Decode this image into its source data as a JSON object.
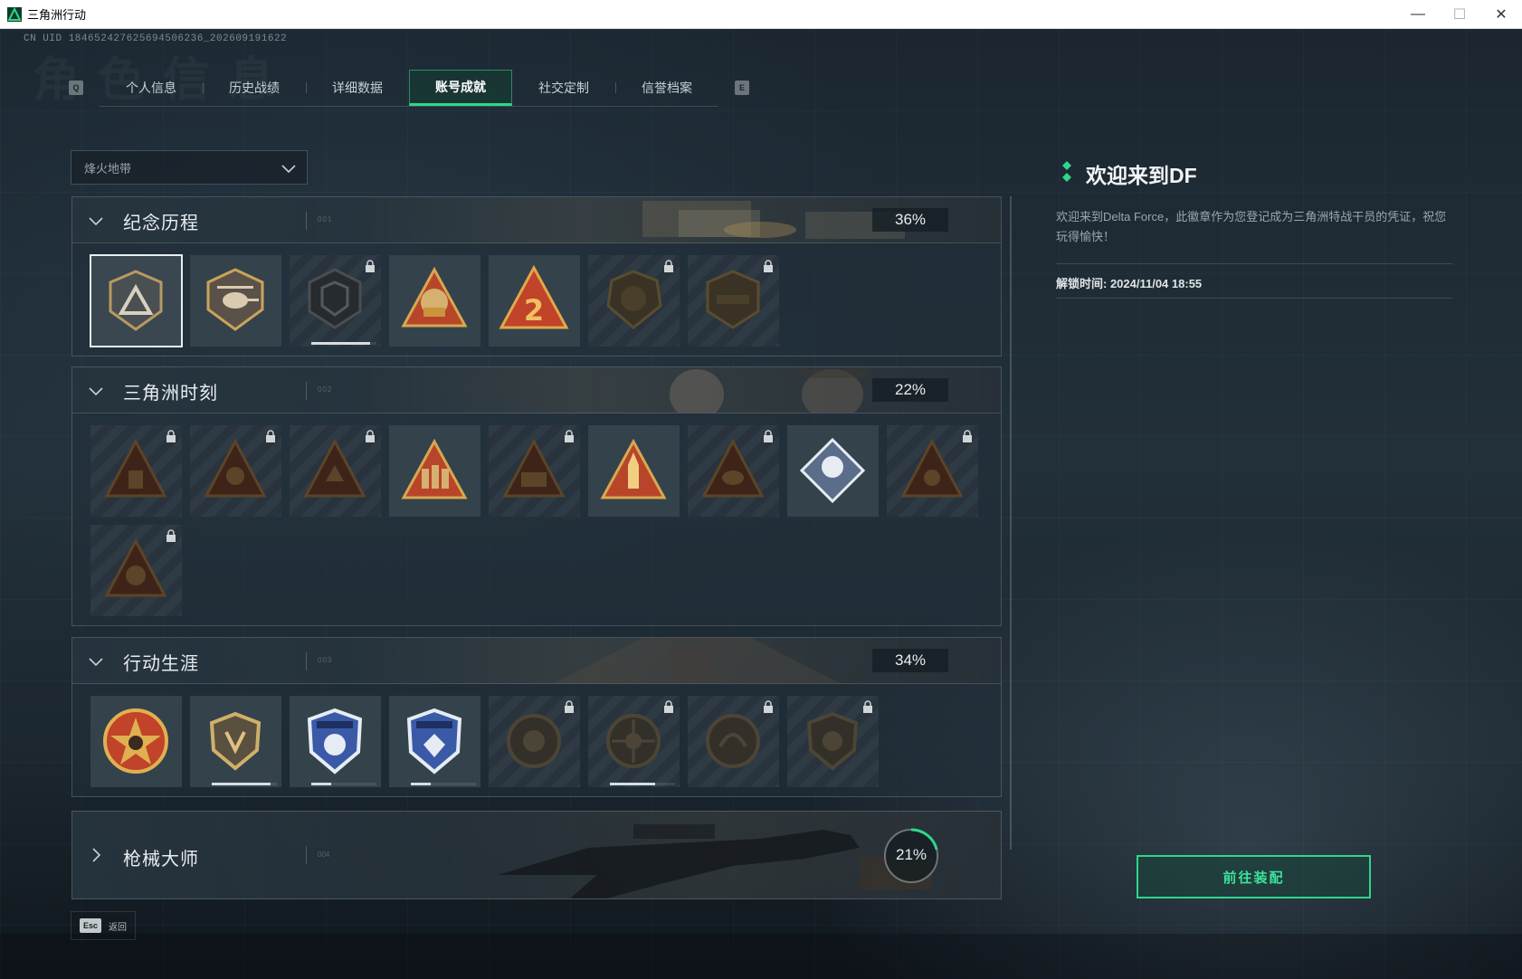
{
  "window": {
    "title": "三角洲行动"
  },
  "uid": "CN UID 184652427625694506236_202609191622",
  "background_title": "角色信息",
  "tabs": {
    "left_key": "Q",
    "right_key": "E",
    "items": [
      {
        "label": "个人信息",
        "active": false
      },
      {
        "label": "历史战绩",
        "active": false
      },
      {
        "label": "详细数据",
        "active": false
      },
      {
        "label": "账号成就",
        "active": true
      },
      {
        "label": "社交定制",
        "active": false
      },
      {
        "label": "信誉档案",
        "active": false
      }
    ]
  },
  "mode_select": {
    "value": "烽火地带"
  },
  "sections": [
    {
      "title": "纪念历程",
      "number": "001",
      "percent": "36%",
      "expanded": true
    },
    {
      "title": "三角洲时刻",
      "number": "002",
      "percent": "22%",
      "expanded": true
    },
    {
      "title": "行动生涯",
      "number": "003",
      "percent": "34%",
      "expanded": true
    },
    {
      "title": "枪械大师",
      "number": "004",
      "percent": "21%",
      "percent_value": 0.21,
      "expanded": false
    }
  ],
  "detail": {
    "title": "欢迎来到DF",
    "description": "欢迎来到Delta Force，此徽章作为您登记成为三角洲特战干员的凭证，祝您玩得愉快！",
    "unlock_time": "解锁时间: 2024/11/04 18:55",
    "equip_button": "前往装配"
  },
  "footer": {
    "esc_key": "Esc",
    "back_label": "返回"
  },
  "colors": {
    "accent": "#2fd68a",
    "badge_gold": "#c9a45a",
    "badge_red": "#b8452a",
    "badge_blue": "#3a5aa8"
  }
}
